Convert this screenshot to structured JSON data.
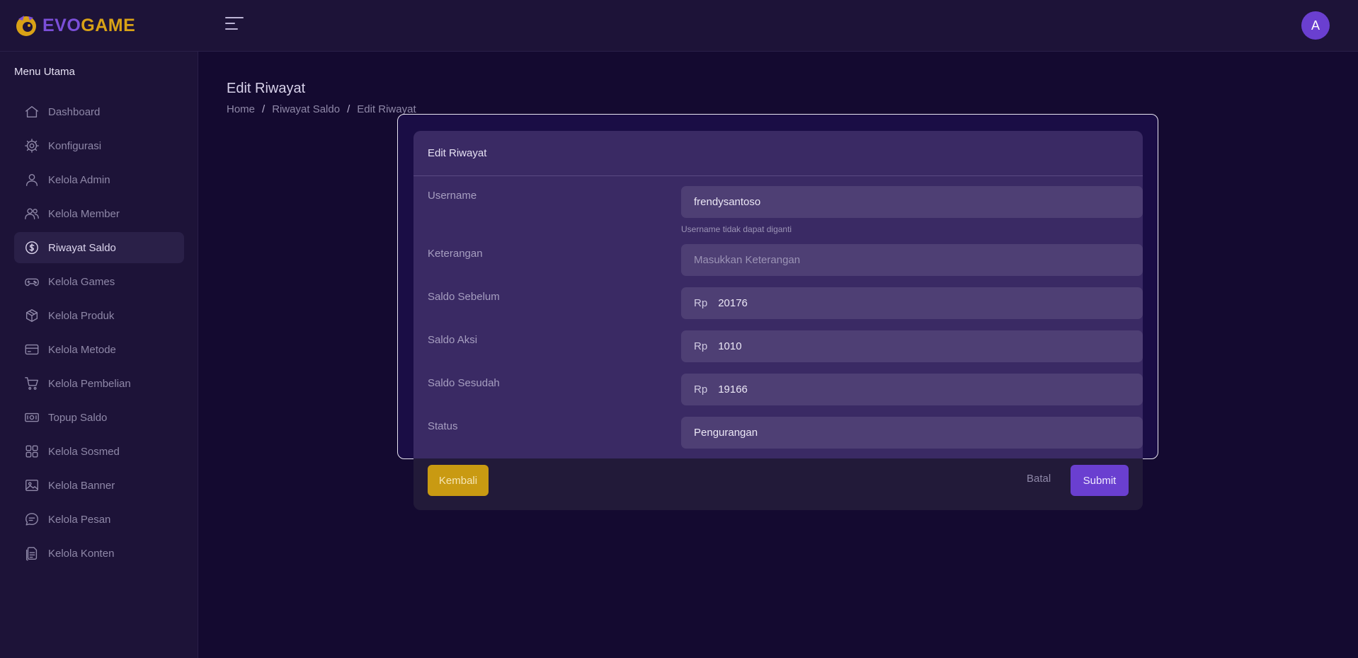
{
  "header": {
    "logo_part1": "EVO",
    "logo_part2": "GAME",
    "avatar_initial": "A"
  },
  "sidebar": {
    "title": "Menu Utama",
    "items": [
      {
        "label": "Dashboard",
        "icon": "home-icon"
      },
      {
        "label": "Konfigurasi",
        "icon": "gear-icon"
      },
      {
        "label": "Kelola Admin",
        "icon": "user-icon"
      },
      {
        "label": "Kelola Member",
        "icon": "users-icon"
      },
      {
        "label": "Riwayat Saldo",
        "icon": "dollar-circle-icon",
        "active": true
      },
      {
        "label": "Kelola Games",
        "icon": "gamepad-icon"
      },
      {
        "label": "Kelola Produk",
        "icon": "box-icon"
      },
      {
        "label": "Kelola Metode",
        "icon": "credit-card-icon"
      },
      {
        "label": "Kelola Pembelian",
        "icon": "cart-icon"
      },
      {
        "label": "Topup Saldo",
        "icon": "banknote-icon"
      },
      {
        "label": "Kelola Sosmed",
        "icon": "grid-icon"
      },
      {
        "label": "Kelola Banner",
        "icon": "image-icon"
      },
      {
        "label": "Kelola Pesan",
        "icon": "chat-icon"
      },
      {
        "label": "Kelola Konten",
        "icon": "document-icon"
      }
    ]
  },
  "page": {
    "title": "Edit Riwayat",
    "breadcrumb": [
      "Home",
      "Riwayat Saldo",
      "Edit Riwayat"
    ]
  },
  "form": {
    "card_title": "Edit Riwayat",
    "username": {
      "label": "Username",
      "value": "frendysantoso",
      "hint": "Username tidak dapat diganti"
    },
    "keterangan": {
      "label": "Keterangan",
      "placeholder": "Masukkan Keterangan"
    },
    "saldo_sebelum": {
      "label": "Saldo Sebelum",
      "prefix": "Rp",
      "value": "20176"
    },
    "saldo_aksi": {
      "label": "Saldo Aksi",
      "prefix": "Rp",
      "value": "1010"
    },
    "saldo_sesudah": {
      "label": "Saldo Sesudah",
      "prefix": "Rp",
      "value": "19166"
    },
    "status": {
      "label": "Status",
      "value": "Pengurangan"
    }
  },
  "actions": {
    "back_label": "Kembali",
    "cancel_label": "Batal",
    "submit_label": "Submit"
  },
  "colors": {
    "accent": "#6a3fd0",
    "gold": "#c99a12",
    "background": "#140a30",
    "sidebar": "#1d1338"
  }
}
